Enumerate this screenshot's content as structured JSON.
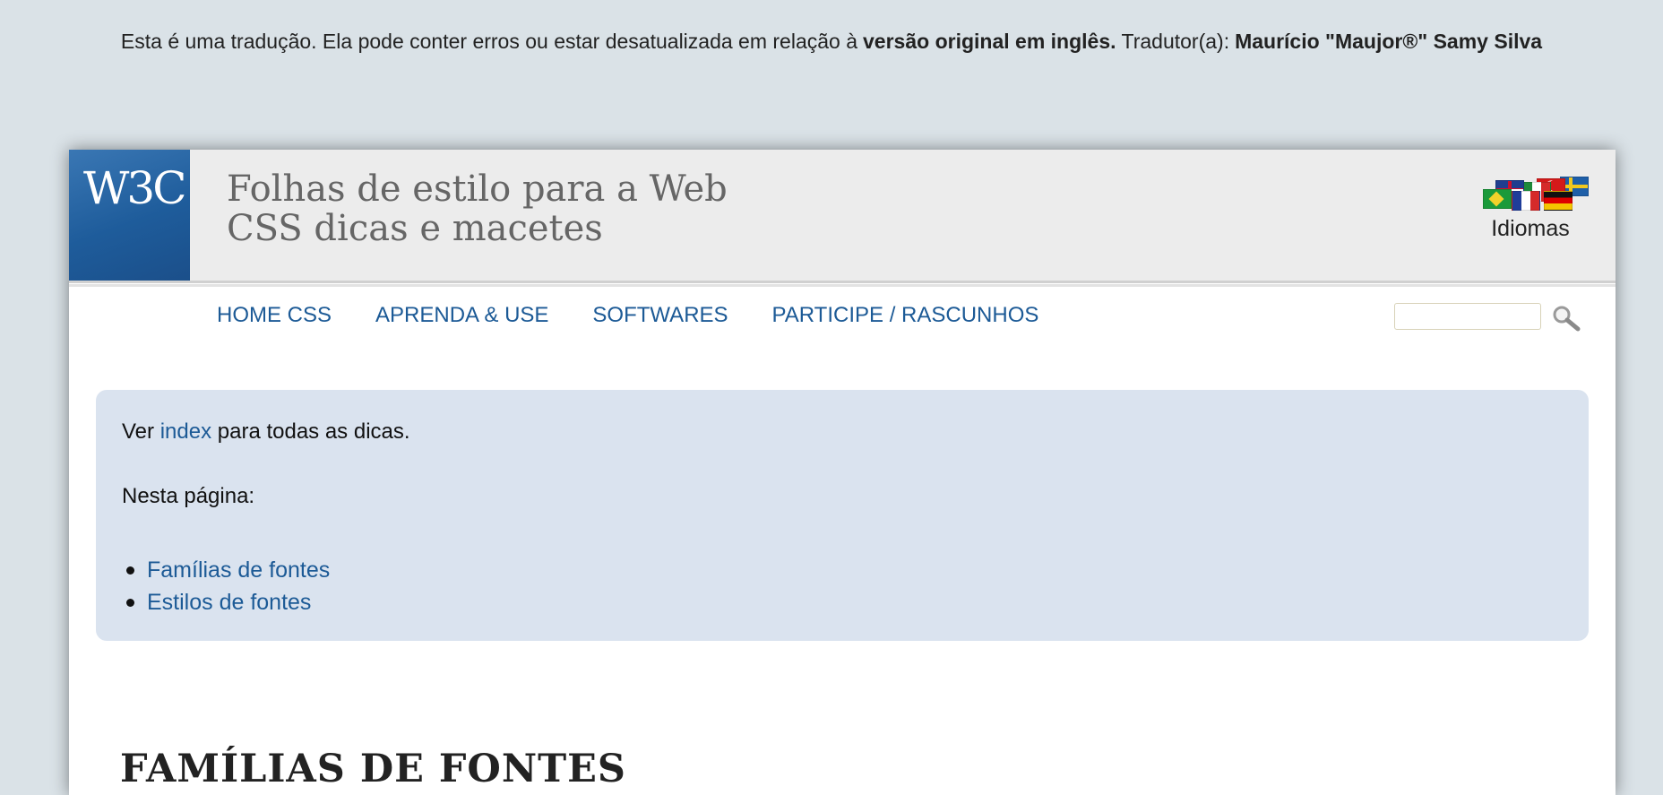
{
  "translation_note": {
    "prefix": "Esta é uma tradução. Ela pode conter erros ou estar desatualizada em relação à",
    "original_link": "versão original em inglês.",
    "translator_label": "Tradutor(a):",
    "translator_name": "Maurício \"Maujor®\" Samy Silva"
  },
  "header": {
    "logo": "W3C",
    "title_line1": "Folhas de estilo para a Web",
    "title_line2": "CSS dicas e macetes",
    "languages_label": "Idiomas"
  },
  "nav": {
    "items": [
      {
        "label": "HOME CSS"
      },
      {
        "label": "APRENDA & USE"
      },
      {
        "label": "SOFTWARES"
      },
      {
        "label": "PARTICIPE / RASCUNHOS"
      }
    ],
    "search": {
      "value": "",
      "placeholder": ""
    }
  },
  "info_box": {
    "see_prefix": "Ver",
    "see_link": "index",
    "see_suffix": "para todas as dicas.",
    "on_page_label": "Nesta página:",
    "toc": [
      {
        "label": "Famílias de fontes"
      },
      {
        "label": "Estilos de fontes"
      }
    ]
  },
  "section": {
    "heading": "FAMÍLIAS DE FONTES"
  },
  "colors": {
    "background": "#dae2e7",
    "link": "#1c5a96",
    "info_box": "#dae3ef",
    "logo_blue": "#1e5c9b"
  }
}
